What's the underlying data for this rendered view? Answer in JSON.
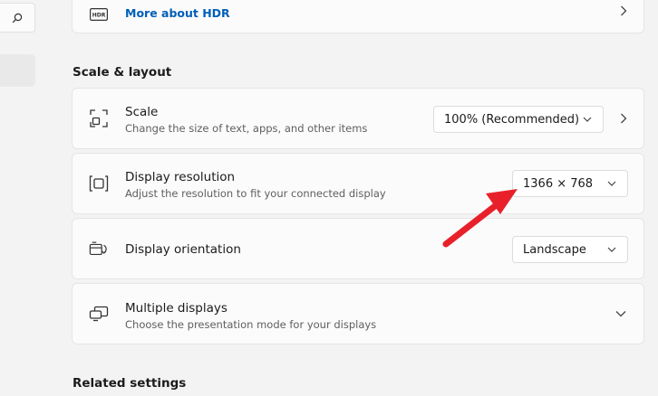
{
  "search": {
    "icon": "search-icon"
  },
  "hdr_card": {
    "link": "More about HDR",
    "icon": "hdr-icon"
  },
  "sections": {
    "scale_layout": "Scale & layout",
    "related": "Related settings"
  },
  "scale": {
    "title": "Scale",
    "subtitle": "Change the size of text, apps, and other items",
    "value": "100% (Recommended)"
  },
  "resolution": {
    "title": "Display resolution",
    "subtitle": "Adjust the resolution to fit your connected display",
    "value": "1366 × 768"
  },
  "orientation": {
    "title": "Display orientation",
    "value": "Landscape"
  },
  "multiple": {
    "title": "Multiple displays",
    "subtitle": "Choose the presentation mode for your displays"
  },
  "colors": {
    "accent_link": "#005fb8",
    "annotation_arrow": "#e8202a"
  }
}
